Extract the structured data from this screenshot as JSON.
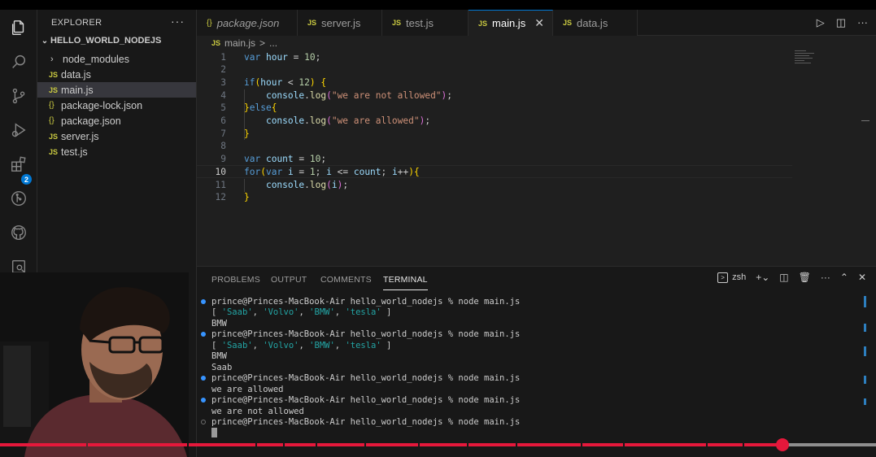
{
  "sidebar": {
    "title": "EXPLORER",
    "more": "···",
    "folder": "HELLO_WORLD_NODEJS",
    "items": [
      {
        "label": "node_modules",
        "icon": "chevron-right"
      },
      {
        "label": "data.js",
        "icon": "JS"
      },
      {
        "label": "main.js",
        "icon": "JS",
        "selected": true
      },
      {
        "label": "package-lock.json",
        "icon": "{}"
      },
      {
        "label": "package.json",
        "icon": "{}"
      },
      {
        "label": "server.js",
        "icon": "JS"
      },
      {
        "label": "test.js",
        "icon": "JS"
      }
    ]
  },
  "activity": {
    "icons": [
      "files-icon",
      "search-icon",
      "source-control-icon",
      "run-debug-icon",
      "extensions-icon",
      "git-graph-icon",
      "github-icon",
      "remote-explorer-icon"
    ],
    "extensions_badge": "2"
  },
  "tabs": [
    {
      "label": "package.json",
      "icon": "{}",
      "italic": true
    },
    {
      "label": "server.js",
      "icon": "JS"
    },
    {
      "label": "test.js",
      "icon": "JS"
    },
    {
      "label": "main.js",
      "icon": "JS",
      "active": true
    },
    {
      "label": "data.js",
      "icon": "JS"
    }
  ],
  "breadcrumb": {
    "icon": "JS",
    "file": "main.js",
    "sep": ">",
    "more": "..."
  },
  "editor": {
    "current_line": 10,
    "line_numbers": [
      "1",
      "2",
      "3",
      "4",
      "5",
      "6",
      "7",
      "8",
      "9",
      "10",
      "11",
      "12"
    ]
  },
  "panel": {
    "tabs": [
      "PROBLEMS",
      "OUTPUT",
      "COMMENTS",
      "TERMINAL"
    ],
    "active_tab": "TERMINAL",
    "shell": "zsh",
    "terminal_lines": [
      {
        "marker": "blue",
        "text": "prince@Princes-MacBook-Air hello_world_nodejs % node main.js"
      },
      {
        "marker": "",
        "text": "[ 'Saab', 'Volvo', 'BMW', 'tesla' ]"
      },
      {
        "marker": "",
        "text": "BMW"
      },
      {
        "marker": "blue",
        "text": "prince@Princes-MacBook-Air hello_world_nodejs % node main.js"
      },
      {
        "marker": "",
        "text": "[ 'Saab', 'Volvo', 'BMW', 'tesla' ]"
      },
      {
        "marker": "",
        "text": "BMW"
      },
      {
        "marker": "",
        "text": "Saab"
      },
      {
        "marker": "blue",
        "text": "prince@Princes-MacBook-Air hello_world_nodejs % node main.js"
      },
      {
        "marker": "",
        "text": "we are allowed"
      },
      {
        "marker": "blue",
        "text": "prince@Princes-MacBook-Air hello_world_nodejs % node main.js"
      },
      {
        "marker": "",
        "text": "we are not allowed"
      },
      {
        "marker": "hollow",
        "text": "prince@Princes-MacBook-Air hello_world_nodejs % node main.js"
      }
    ]
  },
  "video": {
    "progress": 0.893
  },
  "colors": {
    "accent": "#0078d4",
    "progress": "#e5183b",
    "js_icon": "#cbcb41"
  }
}
